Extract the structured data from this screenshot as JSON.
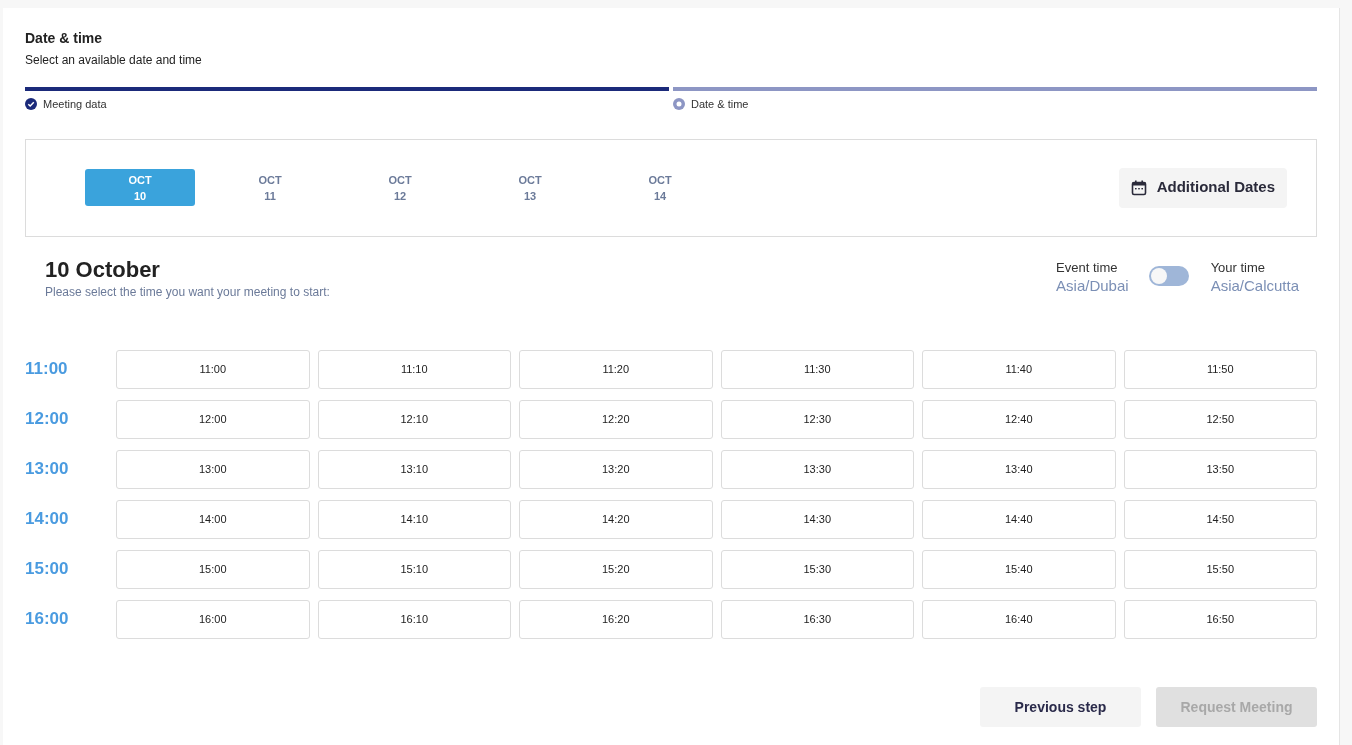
{
  "header": {
    "title": "Date & time",
    "subtitle": "Select an available date and time"
  },
  "steps": [
    {
      "label": "Meeting data",
      "completed": true
    },
    {
      "label": "Date & time",
      "completed": false
    }
  ],
  "dates": [
    {
      "month": "OCT",
      "day": "10",
      "selected": true
    },
    {
      "month": "OCT",
      "day": "11",
      "selected": false
    },
    {
      "month": "OCT",
      "day": "12",
      "selected": false
    },
    {
      "month": "OCT",
      "day": "13",
      "selected": false
    },
    {
      "month": "OCT",
      "day": "14",
      "selected": false
    }
  ],
  "additional_dates_button": "Additional Dates",
  "day_heading": "10 October",
  "day_hint": "Please select the time you want your meeting to start:",
  "timezone": {
    "left_label": "Event time",
    "left_zone": "Asia/Dubai",
    "right_label": "Your time",
    "right_zone": "Asia/Calcutta",
    "on": false
  },
  "slot_rows": [
    {
      "hour": "11:00",
      "slots": [
        "11:00",
        "11:10",
        "11:20",
        "11:30",
        "11:40",
        "11:50"
      ]
    },
    {
      "hour": "12:00",
      "slots": [
        "12:00",
        "12:10",
        "12:20",
        "12:30",
        "12:40",
        "12:50"
      ]
    },
    {
      "hour": "13:00",
      "slots": [
        "13:00",
        "13:10",
        "13:20",
        "13:30",
        "13:40",
        "13:50"
      ]
    },
    {
      "hour": "14:00",
      "slots": [
        "14:00",
        "14:10",
        "14:20",
        "14:30",
        "14:40",
        "14:50"
      ]
    },
    {
      "hour": "15:00",
      "slots": [
        "15:00",
        "15:10",
        "15:20",
        "15:30",
        "15:40",
        "15:50"
      ]
    },
    {
      "hour": "16:00",
      "slots": [
        "16:00",
        "16:10",
        "16:20",
        "16:30",
        "16:40",
        "16:50"
      ]
    }
  ],
  "buttons": [
    {
      "label": "Previous step",
      "disabled": false
    },
    {
      "label": "Request Meeting",
      "disabled": true
    }
  ]
}
